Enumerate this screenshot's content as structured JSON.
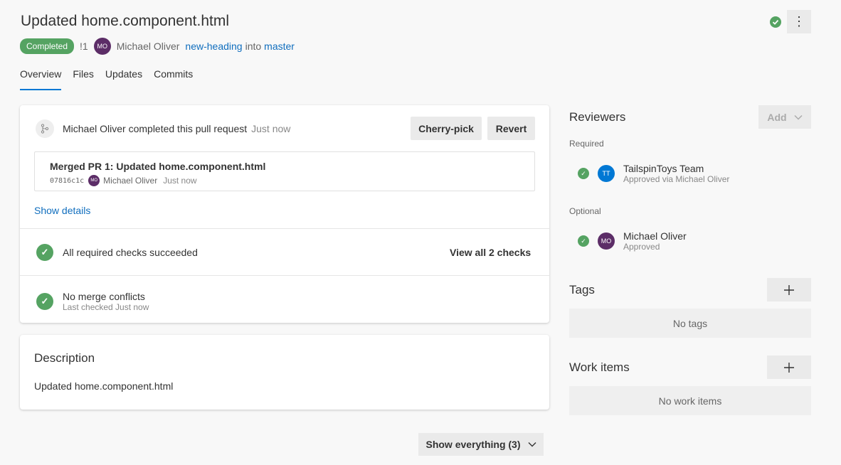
{
  "header": {
    "title": "Updated home.component.html",
    "status_badge": "Completed",
    "pr_id": "!1",
    "author_initials": "MO",
    "author": "Michael Oliver",
    "source_branch": "new-heading",
    "into": "into",
    "target_branch": "master",
    "more_icon": "⋮"
  },
  "tabs": [
    {
      "label": "Overview",
      "active": true
    },
    {
      "label": "Files"
    },
    {
      "label": "Updates"
    },
    {
      "label": "Commits"
    }
  ],
  "activity": {
    "text": "Michael Oliver completed this pull request",
    "time": "Just now",
    "cherry_pick": "Cherry-pick",
    "revert": "Revert",
    "merge_title": "Merged PR 1: Updated home.component.html",
    "commit_hash": "07816c1c",
    "commit_author_initials": "MO",
    "commit_author": "Michael Oliver",
    "commit_time": "Just now",
    "show_details": "Show details"
  },
  "checks": {
    "required_text": "All required checks succeeded",
    "view_all": "View all 2 checks",
    "conflicts_text": "No merge conflicts",
    "conflicts_sub": "Last checked Just now"
  },
  "description": {
    "title": "Description",
    "body": "Updated home.component.html"
  },
  "reviewers": {
    "title": "Reviewers",
    "add_label": "Add",
    "required_label": "Required",
    "optional_label": "Optional",
    "required": [
      {
        "initials": "TT",
        "name": "TailspinToys Team",
        "status": "Approved via Michael Oliver"
      }
    ],
    "optional": [
      {
        "initials": "MO",
        "name": "Michael Oliver",
        "status": "Approved"
      }
    ]
  },
  "tags": {
    "title": "Tags",
    "empty": "No tags"
  },
  "work_items": {
    "title": "Work items",
    "empty": "No work items"
  },
  "footer": {
    "show_everything": "Show everything (3)"
  },
  "colors": {
    "success": "#55a362",
    "link": "#106ebe",
    "accent": "#0078d4",
    "avatar_mo": "#5c2d67",
    "avatar_tt": "#0078d4"
  }
}
